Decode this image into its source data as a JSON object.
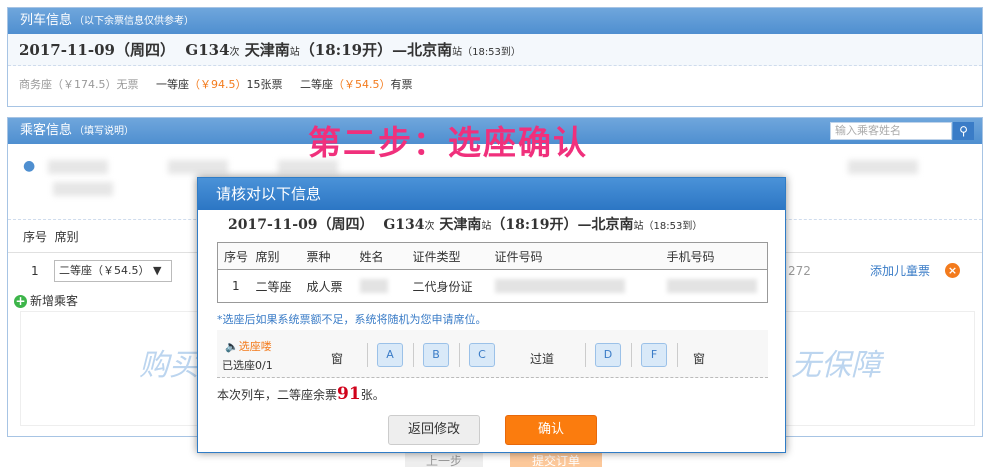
{
  "train_panel": {
    "title": "列车信息",
    "subtitle": "（以下余票信息仅供参考）",
    "date": "2017-11-09（周四）",
    "train_no": "G134",
    "train_suffix": "次",
    "from": "天津南",
    "station_suffix": "站",
    "depart": "（18:19开）—",
    "to": "北京南",
    "to_suffix": "站",
    "arrive": "（18:53到）",
    "seats": [
      {
        "name": "商务座",
        "price": "（￥174.5）",
        "status": "无票"
      },
      {
        "name": "一等座",
        "price": "（￥94.5）",
        "status": "15张票"
      },
      {
        "name": "二等座",
        "price": "（￥54.5）",
        "status": "有票"
      }
    ]
  },
  "passenger_panel": {
    "title": "乘客信息",
    "subtitle": "（填写说明）",
    "search_placeholder": "输入乘客姓名",
    "col_no": "序号",
    "col_seat": "席别",
    "row_no": "1",
    "row_seat": "二等座（￥54.5）",
    "row_seat_arrow": "▼",
    "row_phone_partial": "272",
    "add_child": "添加儿童票",
    "add_passenger": "新增乘客",
    "insurance_left": "购买",
    "insurance_right": "无保障",
    "bottom_prev": "上一步",
    "bottom_submit": "提交订单"
  },
  "step_title": "第二步：选座确认",
  "modal": {
    "title": "请核对以下信息",
    "date": "2017-11-09（周四）",
    "train_no": "G134",
    "train_suffix": "次",
    "from": "天津南",
    "station_suffix": "站",
    "depart": "（18:19开）—",
    "to": "北京南",
    "to_suffix": "站",
    "arrive": "（18:53到）",
    "headers": [
      "序号",
      "席别",
      "票种",
      "姓名",
      "证件类型",
      "证件号码",
      "手机号码"
    ],
    "row": {
      "no": "1",
      "seat": "二等座",
      "ticket": "成人票",
      "idtype": "二代身份证"
    },
    "note": "*选座后如果系统票额不足，系统将随机为您申请席位。",
    "seat_picker": {
      "label": "选座喽",
      "count": "已选座0/1",
      "window_left": "窗",
      "aisle": "过道",
      "window_right": "窗",
      "seats": [
        "A",
        "B",
        "C",
        "D",
        "F"
      ]
    },
    "remain_prefix": "本次列车，二等座余票",
    "remain_num": "91",
    "remain_suffix": "张。",
    "back_label": "返回修改",
    "ok_label": "确认"
  },
  "icons": {
    "user": "user-icon",
    "search": "search-icon",
    "add": "plus-icon",
    "close": "close-icon",
    "horn": "speaker-icon"
  },
  "colors": {
    "header_blue": "#4f8fd0",
    "price_orange": "#f37b1d",
    "step_pink": "#f0307c",
    "confirm_orange": "#fb7c0e"
  }
}
